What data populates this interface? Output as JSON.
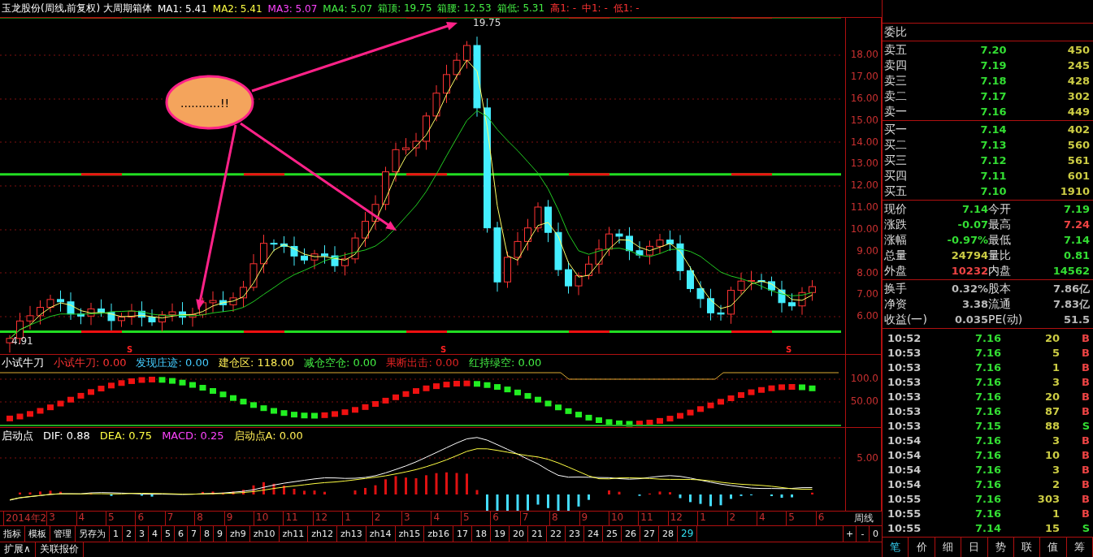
{
  "header": {
    "items": [
      {
        "text": "玉龙股份(周线,前复权) 大周期箱体",
        "color": "#ffffff"
      },
      {
        "text": "MA1: 5.41",
        "color": "#ffffff"
      },
      {
        "text": "MA2: 5.41",
        "color": "#ffff44"
      },
      {
        "text": "MA3: 5.07",
        "color": "#ff44ff"
      },
      {
        "text": "MA4: 5.07",
        "color": "#44ee44"
      },
      {
        "text": "箱顶: 19.75",
        "color": "#44ee44"
      },
      {
        "text": "箱腰: 12.53",
        "color": "#44ee44"
      },
      {
        "text": "箱低: 5.31",
        "color": "#44ee44"
      },
      {
        "text": "高1: -",
        "color": "#ff3333"
      },
      {
        "text": "中1: -",
        "color": "#ff3333"
      },
      {
        "text": "低1: -",
        "color": "#ff3333"
      }
    ]
  },
  "price_pane": {
    "high_label": "19.75",
    "low_label": "4.91",
    "callout": "...........!!",
    "markers": [
      "S",
      "S",
      "S"
    ],
    "axis": [
      "18.00",
      "17.00",
      "16.00",
      "15.00",
      "14.00",
      "13.00",
      "12.00",
      "11.00",
      "10.00",
      "9.00",
      "8.00",
      "7.00",
      "6.00"
    ]
  },
  "indicator_pane": {
    "legend": [
      {
        "text": "小试牛刀",
        "color": "#ffffff"
      },
      {
        "text": "小试牛刀: 0.00",
        "color": "#ff3333"
      },
      {
        "text": "发现庄迹: 0.00",
        "color": "#44ccff"
      },
      {
        "text": "建仓区: 118.00",
        "color": "#ffee55"
      },
      {
        "text": "减仓空仓: 0.00",
        "color": "#44ee44"
      },
      {
        "text": "果断出击: 0.00",
        "color": "#dd2222"
      },
      {
        "text": "红持绿空: 0.00",
        "color": "#44ee44"
      }
    ],
    "axis": [
      "100.0",
      "50.00"
    ]
  },
  "macd_pane": {
    "legend": [
      {
        "text": "启动点",
        "color": "#ffffff"
      },
      {
        "text": "DIF: 0.88",
        "color": "#ffffff"
      },
      {
        "text": "DEA: 0.75",
        "color": "#ffff44"
      },
      {
        "text": "MACD: 0.25",
        "color": "#ff44ff"
      },
      {
        "text": "启动点A: 0.00",
        "color": "#ffee55"
      }
    ],
    "axis": [
      "5.00"
    ]
  },
  "date_axis": {
    "labels": [
      "2014年2",
      "3",
      "4",
      "5",
      "6",
      "7",
      "8",
      "9",
      "10",
      "11",
      "12",
      "1",
      "2",
      "3",
      "4",
      "5",
      "6",
      "7",
      "8",
      "9",
      "10",
      "11",
      "12",
      "1",
      "2",
      "4",
      "5",
      "6"
    ],
    "period": "周线"
  },
  "toolbar": {
    "tabs": [
      {
        "label": "指标",
        "selected": false
      },
      {
        "label": "模板",
        "selected": false
      },
      {
        "label": "管理",
        "selected": false
      },
      {
        "label": "另存为",
        "selected": false
      },
      {
        "label": "1",
        "selected": false
      },
      {
        "label": "2",
        "selected": false
      },
      {
        "label": "3",
        "selected": false
      },
      {
        "label": "4",
        "selected": false
      },
      {
        "label": "5",
        "selected": false
      },
      {
        "label": "6",
        "selected": false
      },
      {
        "label": "7",
        "selected": false
      },
      {
        "label": "8",
        "selected": false
      },
      {
        "label": "9",
        "selected": false
      },
      {
        "label": "zh9",
        "selected": false
      },
      {
        "label": "zh10",
        "selected": false
      },
      {
        "label": "zh11",
        "selected": false
      },
      {
        "label": "zh12",
        "selected": false
      },
      {
        "label": "zh13",
        "selected": false
      },
      {
        "label": "zh14",
        "selected": false
      },
      {
        "label": "zh15",
        "selected": false
      },
      {
        "label": "zb16",
        "selected": false
      },
      {
        "label": "17",
        "selected": false
      },
      {
        "label": "18",
        "selected": false
      },
      {
        "label": "19",
        "selected": false
      },
      {
        "label": "20",
        "selected": false
      },
      {
        "label": "21",
        "selected": false
      },
      {
        "label": "22",
        "selected": false
      },
      {
        "label": "23",
        "selected": false
      },
      {
        "label": "24",
        "selected": false
      },
      {
        "label": "25",
        "selected": false
      },
      {
        "label": "26",
        "selected": false
      },
      {
        "label": "27",
        "selected": false
      },
      {
        "label": "28",
        "selected": false
      },
      {
        "label": "29",
        "selected": true
      }
    ],
    "controls": [
      "+",
      "-",
      "0"
    ]
  },
  "bottom_tabs": [
    "扩展∧",
    "关联报价"
  ],
  "quote": {
    "ratio_label": "委比",
    "asks": [
      {
        "label": "卖五",
        "price": "7.20",
        "volume": "450"
      },
      {
        "label": "卖四",
        "price": "7.19",
        "volume": "245"
      },
      {
        "label": "卖三",
        "price": "7.18",
        "volume": "428"
      },
      {
        "label": "卖二",
        "price": "7.17",
        "volume": "302"
      },
      {
        "label": "卖一",
        "price": "7.16",
        "volume": "449"
      }
    ],
    "bids": [
      {
        "label": "买一",
        "price": "7.14",
        "volume": "402"
      },
      {
        "label": "买二",
        "price": "7.13",
        "volume": "560"
      },
      {
        "label": "买三",
        "price": "7.12",
        "volume": "561"
      },
      {
        "label": "买四",
        "price": "7.11",
        "volume": "601"
      },
      {
        "label": "买五",
        "price": "7.10",
        "volume": "1910"
      }
    ],
    "stats": [
      {
        "cells": [
          {
            "label": "现价",
            "value": "7.14",
            "color": "#33dd33"
          },
          {
            "label": "今开",
            "value": "7.19",
            "color": "#33dd33"
          }
        ]
      },
      {
        "cells": [
          {
            "label": "涨跌",
            "value": "-0.07",
            "color": "#33dd33"
          },
          {
            "label": "最高",
            "value": "7.24",
            "color": "#ee4444"
          }
        ]
      },
      {
        "cells": [
          {
            "label": "涨幅",
            "value": "-0.97%",
            "color": "#33dd33"
          },
          {
            "label": "最低",
            "value": "7.14",
            "color": "#33dd33"
          }
        ]
      },
      {
        "cells": [
          {
            "label": "总量",
            "value": "24794",
            "color": "#cccc44"
          },
          {
            "label": "量比",
            "value": "0.81",
            "color": "#33dd33"
          }
        ]
      },
      {
        "cells": [
          {
            "label": "外盘",
            "value": "10232",
            "color": "#ee4444"
          },
          {
            "label": "内盘",
            "value": "14562",
            "color": "#33dd33"
          }
        ]
      }
    ],
    "finance": [
      {
        "cells": [
          {
            "label": "换手",
            "value": "0.32%"
          },
          {
            "label": "股本",
            "value": "7.86亿"
          }
        ]
      },
      {
        "cells": [
          {
            "label": "净资",
            "value": "3.38"
          },
          {
            "label": "流通",
            "value": "7.83亿"
          }
        ]
      },
      {
        "cells": [
          {
            "label": "收益(一)",
            "value": "0.035"
          },
          {
            "label": "PE(动)",
            "value": "51.5"
          }
        ]
      }
    ]
  },
  "ticks": [
    {
      "time": "10:52",
      "price": "7.16",
      "volume": "20",
      "side": "B",
      "color": "#ee4444"
    },
    {
      "time": "10:53",
      "price": "7.16",
      "volume": "5",
      "side": "B",
      "color": "#ee4444"
    },
    {
      "time": "10:53",
      "price": "7.16",
      "volume": "1",
      "side": "B",
      "color": "#ee4444"
    },
    {
      "time": "10:53",
      "price": "7.16",
      "volume": "3",
      "side": "B",
      "color": "#ee4444"
    },
    {
      "time": "10:53",
      "price": "7.16",
      "volume": "20",
      "side": "B",
      "color": "#ee4444"
    },
    {
      "time": "10:53",
      "price": "7.16",
      "volume": "87",
      "side": "B",
      "color": "#ee4444"
    },
    {
      "time": "10:53",
      "price": "7.15",
      "volume": "88",
      "side": "S",
      "color": "#33dd33"
    },
    {
      "time": "10:54",
      "price": "7.16",
      "volume": "3",
      "side": "B",
      "color": "#ee4444"
    },
    {
      "time": "10:54",
      "price": "7.16",
      "volume": "10",
      "side": "B",
      "color": "#ee4444"
    },
    {
      "time": "10:54",
      "price": "7.16",
      "volume": "3",
      "side": "B",
      "color": "#ee4444"
    },
    {
      "time": "10:54",
      "price": "7.16",
      "volume": "2",
      "side": "B",
      "color": "#ee4444"
    },
    {
      "time": "10:55",
      "price": "7.16",
      "volume": "303",
      "side": "B",
      "color": "#ee4444"
    },
    {
      "time": "10:55",
      "price": "7.16",
      "volume": "1",
      "side": "B",
      "color": "#ee4444"
    },
    {
      "time": "10:55",
      "price": "7.14",
      "volume": "15",
      "side": "S",
      "color": "#33dd33"
    }
  ],
  "side_tabs": [
    {
      "label": "笔",
      "selected": true
    },
    {
      "label": "价",
      "selected": false
    },
    {
      "label": "细",
      "selected": false
    },
    {
      "label": "日",
      "selected": false
    },
    {
      "label": "势",
      "selected": false
    },
    {
      "label": "联",
      "selected": false
    },
    {
      "label": "值",
      "selected": false
    },
    {
      "label": "筹",
      "selected": false
    }
  ]
}
